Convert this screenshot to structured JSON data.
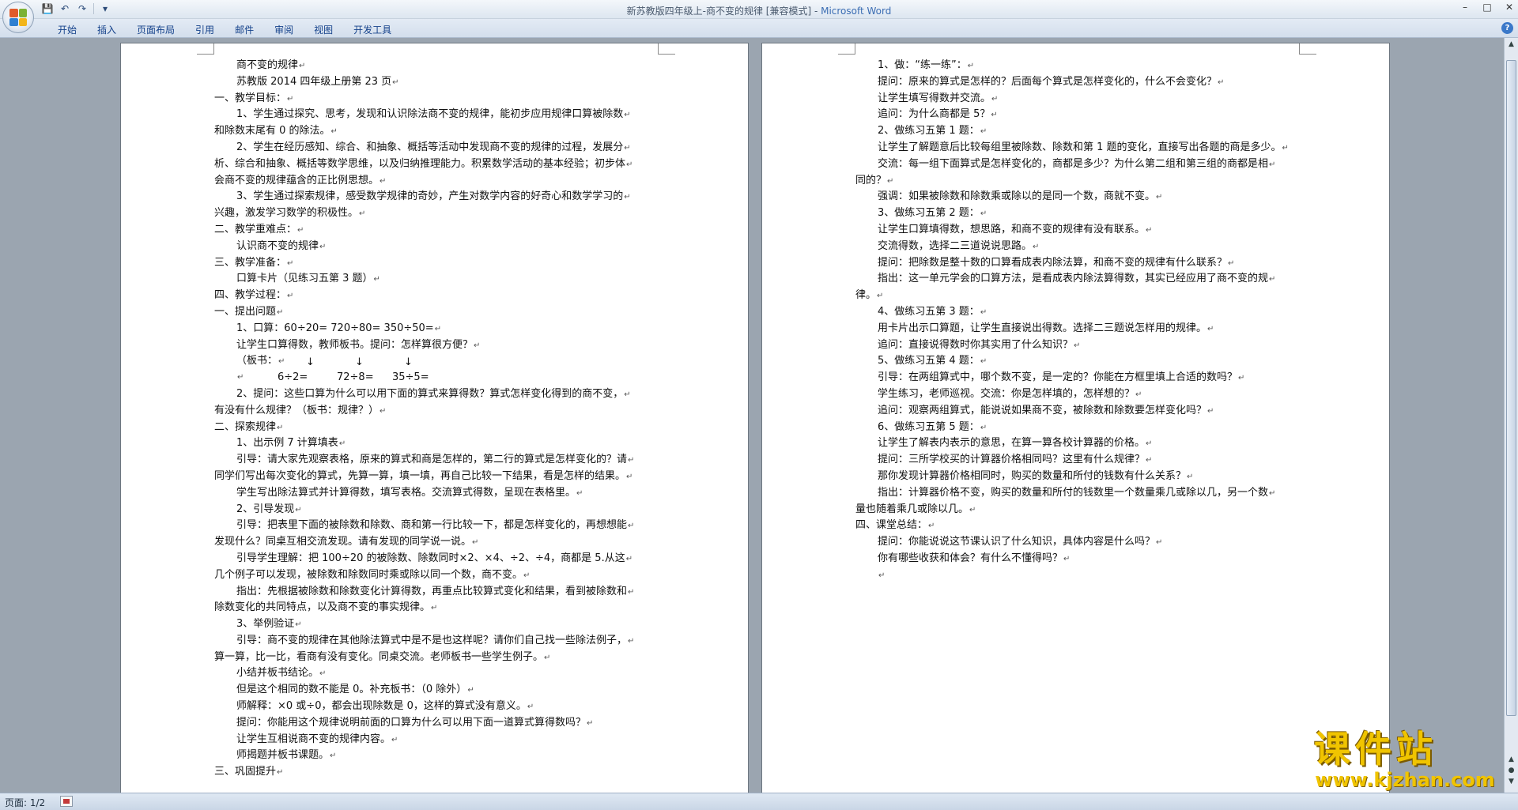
{
  "window": {
    "title": "新苏教版四年级上-商不变的规律 [兼容模式] - ",
    "app_name": "Microsoft Word"
  },
  "ribbon": {
    "tabs": [
      "开始",
      "插入",
      "页面布局",
      "引用",
      "邮件",
      "审阅",
      "视图",
      "开发工具"
    ]
  },
  "status": {
    "page": "页面: 1/2"
  },
  "watermark": {
    "title": "课件站",
    "url": "www.kjzhan.com"
  },
  "page1": {
    "lines": [
      {
        "t": "商不变的规律",
        "i": 1
      },
      {
        "t": "苏教版 2014 四年级上册第 23 页",
        "i": 1
      },
      {
        "t": "一、教学目标：",
        "i": 0
      },
      {
        "t": "1、学生通过探究、思考，发现和认识除法商不变的规律，能初步应用规律口算被除数",
        "i": 1
      },
      {
        "t": "和除数末尾有 0 的除法。",
        "i": 0
      },
      {
        "t": "2、学生在经历感知、综合、和抽象、概括等活动中发现商不变的规律的过程，发展分",
        "i": 1
      },
      {
        "t": "析、综合和抽象、概括等数学思维，以及归纳推理能力。积累数学活动的基本经验；初步体",
        "i": 0
      },
      {
        "t": "会商不变的规律蕴含的正比例思想。",
        "i": 0
      },
      {
        "t": "3、学生通过探索规律，感受数学规律的奇妙，产生对数学内容的好奇心和数学学习的",
        "i": 1
      },
      {
        "t": "兴趣，激发学习数学的积极性。",
        "i": 0
      },
      {
        "t": "二、教学重难点：",
        "i": 0
      },
      {
        "t": "认识商不变的规律",
        "i": 1
      },
      {
        "t": "三、教学准备：",
        "i": 0
      },
      {
        "t": "口算卡片（见练习五第 3 题）",
        "i": 1
      },
      {
        "t": "四、教学过程：",
        "i": 0
      },
      {
        "t": "一、提出问题",
        "i": 0
      },
      {
        "t": "1、口算：60÷20=     720÷80=     350÷50=",
        "i": 1
      },
      {
        "t": "让学生口算得数，教师板书。提问：怎样算很方便？",
        "i": 1
      },
      {
        "t": "（板书：",
        "i": 1,
        "arrows": true
      },
      {
        "t": "",
        "i": 1,
        "calc": [
          "6÷2=",
          "72÷8=",
          "35÷5="
        ]
      },
      {
        "t": "2、提问：这些口算为什么可以用下面的算式来算得数？算式怎样变化得到的商不变，",
        "i": 1
      },
      {
        "t": "有没有什么规律？（板书：规律？）",
        "i": 0
      },
      {
        "t": "二、探索规律",
        "i": 0
      },
      {
        "t": "1、出示例 7 计算填表",
        "i": 1
      },
      {
        "t": "引导：请大家先观察表格，原来的算式和商是怎样的，第二行的算式是怎样变化的？请",
        "i": 1
      },
      {
        "t": "同学们写出每次变化的算式，先算一算，填一填，再自己比较一下结果，看是怎样的结果。",
        "i": 0
      },
      {
        "t": "学生写出除法算式并计算得数，填写表格。交流算式得数，呈现在表格里。",
        "i": 1
      },
      {
        "t": "2、引导发现",
        "i": 1
      },
      {
        "t": "引导：把表里下面的被除数和除数、商和第一行比较一下，都是怎样变化的，再想想能",
        "i": 1
      },
      {
        "t": "发现什么？同桌互相交流发现。请有发现的同学说一说。",
        "i": 0
      },
      {
        "t": "引导学生理解：把 100÷20 的被除数、除数同时×2、×4、÷2、÷4，商都是 5.从这",
        "i": 1
      },
      {
        "t": "几个例子可以发现，被除数和除数同时乘或除以同一个数，商不变。",
        "i": 0
      },
      {
        "t": "指出：先根据被除数和除数变化计算得数，再重点比较算式变化和结果，看到被除数和",
        "i": 1
      },
      {
        "t": "除数变化的共同特点，以及商不变的事实规律。",
        "i": 0
      },
      {
        "t": "3、举例验证",
        "i": 1
      },
      {
        "t": "引导：商不变的规律在其他除法算式中是不是也这样呢？请你们自己找一些除法例子，",
        "i": 1
      },
      {
        "t": "算一算，比一比，看商有没有变化。同桌交流。老师板书一些学生例子。",
        "i": 0
      },
      {
        "t": "小结并板书结论。",
        "i": 1
      },
      {
        "t": "但是这个相同的数不能是 0。补充板书：（0 除外）",
        "i": 1
      },
      {
        "t": "师解释：×0 或÷0，都会出现除数是 0，这样的算式没有意义。",
        "i": 1
      },
      {
        "t": "提问：你能用这个规律说明前面的口算为什么可以用下面一道算式算得数吗？",
        "i": 1
      },
      {
        "t": "让学生互相说商不变的规律内容。",
        "i": 1
      },
      {
        "t": "师揭题并板书课题。",
        "i": 1
      },
      {
        "t": "三、巩固提升",
        "i": 0
      }
    ]
  },
  "page2": {
    "lines": [
      {
        "t": "1、做：“练一练”：",
        "i": 1
      },
      {
        "t": "提问：原来的算式是怎样的？后面每个算式是怎样变化的，什么不会变化？",
        "i": 1
      },
      {
        "t": "让学生填写得数并交流。",
        "i": 1
      },
      {
        "t": "追问：为什么商都是 5？",
        "i": 1
      },
      {
        "t": "2、做练习五第 1 题：",
        "i": 1
      },
      {
        "t": "让学生了解题意后比较每组里被除数、除数和第 1 题的变化，直接写出各题的商是多少。",
        "i": 1
      },
      {
        "t": "交流：每一组下面算式是怎样变化的，商都是多少？为什么第二组和第三组的商都是相",
        "i": 1
      },
      {
        "t": "同的？",
        "i": 0
      },
      {
        "t": "强调：如果被除数和除数乘或除以的是同一个数，商就不变。",
        "i": 1
      },
      {
        "t": "3、做练习五第 2 题：",
        "i": 1
      },
      {
        "t": "让学生口算填得数，想思路，和商不变的规律有没有联系。",
        "i": 1
      },
      {
        "t": "交流得数，选择二三道说说思路。",
        "i": 1
      },
      {
        "t": "提问：把除数是整十数的口算看成表内除法算，和商不变的规律有什么联系？",
        "i": 1
      },
      {
        "t": "指出：这一单元学会的口算方法，是看成表内除法算得数，其实已经应用了商不变的规",
        "i": 1
      },
      {
        "t": "律。",
        "i": 0
      },
      {
        "t": "4、做练习五第 3 题：",
        "i": 1
      },
      {
        "t": "用卡片出示口算题，让学生直接说出得数。选择二三题说怎样用的规律。",
        "i": 1
      },
      {
        "t": "追问：直接说得数时你其实用了什么知识？",
        "i": 1
      },
      {
        "t": "5、做练习五第 4 题：",
        "i": 1
      },
      {
        "t": "引导：在两组算式中，哪个数不变，是一定的？你能在方框里填上合适的数吗？",
        "i": 1
      },
      {
        "t": "学生练习，老师巡视。交流：你是怎样填的，怎样想的？",
        "i": 1
      },
      {
        "t": "追问：观察两组算式，能说说如果商不变，被除数和除数要怎样变化吗？",
        "i": 1
      },
      {
        "t": "6、做练习五第 5 题：",
        "i": 1
      },
      {
        "t": "让学生了解表内表示的意思，在算一算各校计算器的价格。",
        "i": 1
      },
      {
        "t": "提问：三所学校买的计算器价格相同吗？这里有什么规律？",
        "i": 1
      },
      {
        "t": "那你发现计算器价格相同时，购买的数量和所付的钱数有什么关系？",
        "i": 1
      },
      {
        "t": "指出：计算器价格不变，购买的数量和所付的钱数里一个数量乘几或除以几，另一个数",
        "i": 1
      },
      {
        "t": "量也随着乘几或除以几。",
        "i": 0
      },
      {
        "t": "四、课堂总结：",
        "i": 0
      },
      {
        "t": "提问：你能说说这节课认识了什么知识，具体内容是什么吗？",
        "i": 1
      },
      {
        "t": "你有哪些收获和体会？有什么不懂得吗？",
        "i": 1
      },
      {
        "t": "",
        "i": 1
      }
    ]
  },
  "colors": {
    "accent": "#15428b",
    "watermark": "#f0c400"
  }
}
